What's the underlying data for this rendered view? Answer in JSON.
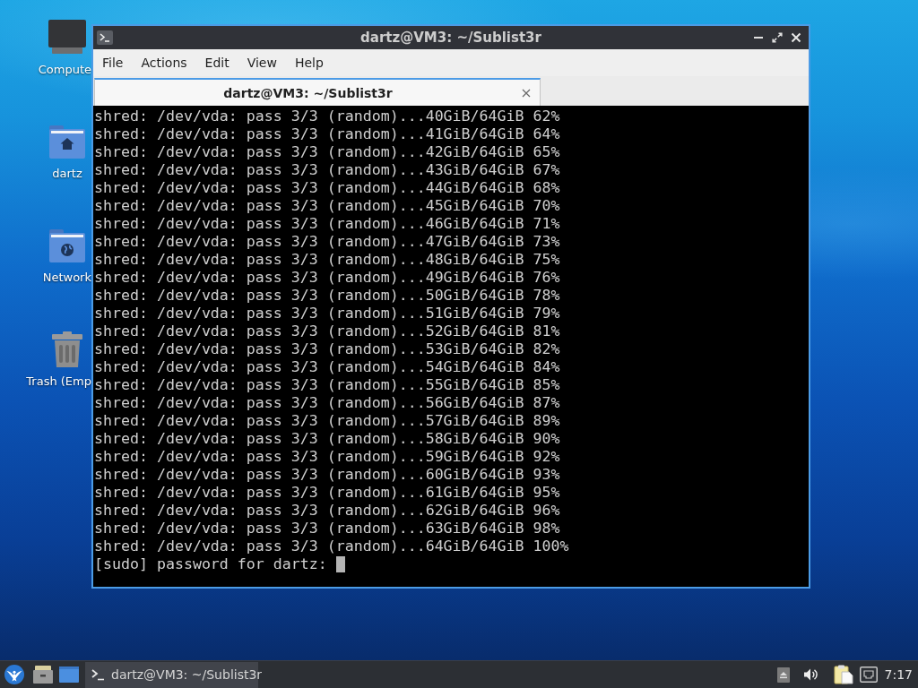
{
  "desktop_icons": [
    {
      "kind": "computer",
      "label": "Compute"
    },
    {
      "kind": "home",
      "label": "dartz"
    },
    {
      "kind": "network",
      "label": "Network"
    },
    {
      "kind": "trash",
      "label": "Trash (Emp"
    }
  ],
  "window": {
    "title": "dartz@VM3: ~/Sublist3r",
    "menu": [
      "File",
      "Actions",
      "Edit",
      "View",
      "Help"
    ],
    "tabs": [
      {
        "label": "dartz@VM3: ~/Sublist3r",
        "selected": true
      }
    ],
    "terminal": {
      "lines": [
        "shred: /dev/vda: pass 3/3 (random)...40GiB/64GiB 62%",
        "shred: /dev/vda: pass 3/3 (random)...41GiB/64GiB 64%",
        "shred: /dev/vda: pass 3/3 (random)...42GiB/64GiB 65%",
        "shred: /dev/vda: pass 3/3 (random)...43GiB/64GiB 67%",
        "shred: /dev/vda: pass 3/3 (random)...44GiB/64GiB 68%",
        "shred: /dev/vda: pass 3/3 (random)...45GiB/64GiB 70%",
        "shred: /dev/vda: pass 3/3 (random)...46GiB/64GiB 71%",
        "shred: /dev/vda: pass 3/3 (random)...47GiB/64GiB 73%",
        "shred: /dev/vda: pass 3/3 (random)...48GiB/64GiB 75%",
        "shred: /dev/vda: pass 3/3 (random)...49GiB/64GiB 76%",
        "shred: /dev/vda: pass 3/3 (random)...50GiB/64GiB 78%",
        "shred: /dev/vda: pass 3/3 (random)...51GiB/64GiB 79%",
        "shred: /dev/vda: pass 3/3 (random)...52GiB/64GiB 81%",
        "shred: /dev/vda: pass 3/3 (random)...53GiB/64GiB 82%",
        "shred: /dev/vda: pass 3/3 (random)...54GiB/64GiB 84%",
        "shred: /dev/vda: pass 3/3 (random)...55GiB/64GiB 85%",
        "shred: /dev/vda: pass 3/3 (random)...56GiB/64GiB 87%",
        "shred: /dev/vda: pass 3/3 (random)...57GiB/64GiB 89%",
        "shred: /dev/vda: pass 3/3 (random)...58GiB/64GiB 90%",
        "shred: /dev/vda: pass 3/3 (random)...59GiB/64GiB 92%",
        "shred: /dev/vda: pass 3/3 (random)...60GiB/64GiB 93%",
        "shred: /dev/vda: pass 3/3 (random)...61GiB/64GiB 95%",
        "shred: /dev/vda: pass 3/3 (random)...62GiB/64GiB 96%",
        "shred: /dev/vda: pass 3/3 (random)...63GiB/64GiB 98%",
        "shred: /dev/vda: pass 3/3 (random)...64GiB/64GiB 100%"
      ],
      "prompt": "[sudo] password for dartz:"
    }
  },
  "taskbar": {
    "tasks": [
      {
        "label": "dartz@VM3: ~/Sublist3r",
        "selected": true
      }
    ],
    "clock": "7:17"
  }
}
